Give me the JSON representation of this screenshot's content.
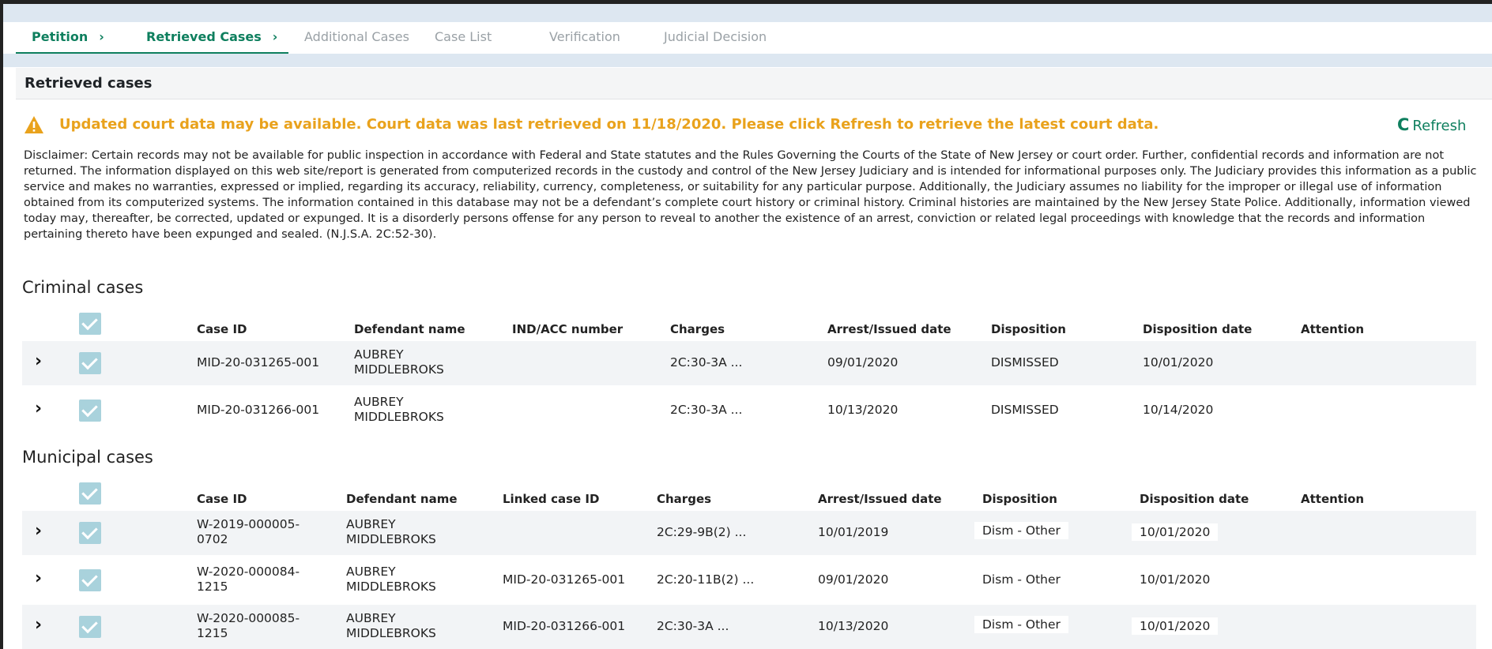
{
  "steps": [
    {
      "label": "Petition",
      "chevron": "›",
      "state": "active"
    },
    {
      "label": "Retrieved Cases",
      "chevron": "›",
      "state": "active"
    },
    {
      "label": "Additional Cases",
      "state": "inactive"
    },
    {
      "label": "Case List",
      "state": "inactive"
    },
    {
      "label": "Verification",
      "state": "inactive"
    },
    {
      "label": "Judicial Decision",
      "state": "inactive"
    }
  ],
  "section": {
    "title": "Retrieved cases"
  },
  "alert": {
    "icon": "warning-icon",
    "text": "Updated court data may be available. Court data was last retrieved on 11/18/2020. Please click Refresh to retrieve the latest court data.",
    "color": "#e9a21c"
  },
  "refresh": {
    "icon": "refresh-icon",
    "glyph": "C",
    "label": "Refresh",
    "color": "#0e7f5e"
  },
  "disclaimer": "Disclaimer: Certain records may not be available for public inspection in accordance with Federal and State statutes and the Rules Governing the Courts of the State of New Jersey or court order. Further, confidential records and information are not returned. The information displayed on this web site/report is generated from computerized records in the custody and control of the New Jersey Judiciary and is intended for informational purposes only. The Judiciary provides this information as a public service and makes no warranties, expressed or implied, regarding its accuracy, reliability, currency, completeness, or suitability for any particular purpose. Additionally, the Judiciary assumes no liability for the improper or illegal use of information obtained from its computerized systems. The information contained in this database may not be a defendant’s complete court history or criminal history. Criminal histories are maintained by the New Jersey State Police. Additionally, information viewed today may, thereafter, be corrected, updated or expunged. It is a disorderly persons offense for any person to reveal to another the existence of an arrest, conviction or related legal proceedings with knowledge that the records and information pertaining thereto have been expunged and sealed. (N.J.S.A. 2C:52-30).",
  "criminal": {
    "title": "Criminal cases",
    "headers": [
      "Case ID",
      "Defendant name",
      "IND/ACC number",
      "Charges",
      "Arrest/Issued date",
      "Disposition",
      "Disposition date",
      "Attention"
    ],
    "rows": [
      {
        "case_id": [
          "MID-20-031265-001"
        ],
        "defendant": [
          "AUBREY",
          "MIDDLEBROKS"
        ],
        "ind_acc": "",
        "charges": "2C:30-3A ...",
        "arrest_date": "09/01/2020",
        "disposition": "DISMISSED",
        "disposition_date": "10/01/2020",
        "attention": ""
      },
      {
        "case_id": [
          "MID-20-031266-001"
        ],
        "defendant": [
          "AUBREY",
          "MIDDLEBROKS"
        ],
        "ind_acc": "",
        "charges": "2C:30-3A ...",
        "arrest_date": "10/13/2020",
        "disposition": "DISMISSED",
        "disposition_date": "10/14/2020",
        "attention": ""
      }
    ]
  },
  "municipal": {
    "title": "Municipal cases",
    "headers": [
      "Case ID",
      "Defendant name",
      "Linked case ID",
      "Charges",
      "Arrest/Issued date",
      "Disposition",
      "Disposition date",
      "Attention"
    ],
    "rows": [
      {
        "case_id": [
          "W-2019-000005-",
          "0702"
        ],
        "defendant": [
          "AUBREY",
          "MIDDLEBROKS"
        ],
        "linked": "",
        "charges": "2C:29-9B(2) ...",
        "arrest_date": "10/01/2019",
        "disposition": "Dism - Other",
        "disposition_date": "10/01/2020",
        "attention": ""
      },
      {
        "case_id": [
          "W-2020-000084-",
          "1215"
        ],
        "defendant": [
          "AUBREY",
          "MIDDLEBROKS"
        ],
        "linked": "MID-20-031265-001",
        "charges": "2C:20-11B(2) ...",
        "arrest_date": "09/01/2020",
        "disposition": "Dism - Other",
        "disposition_date": "10/01/2020",
        "attention": ""
      },
      {
        "case_id": [
          "W-2020-000085-",
          "1215"
        ],
        "defendant": [
          "AUBREY",
          "MIDDLEBROKS"
        ],
        "linked": "MID-20-031266-001",
        "charges": "2C:30-3A ...",
        "arrest_date": "10/13/2020",
        "disposition": "Dism - Other",
        "disposition_date": "10/01/2020",
        "attention": ""
      }
    ]
  }
}
